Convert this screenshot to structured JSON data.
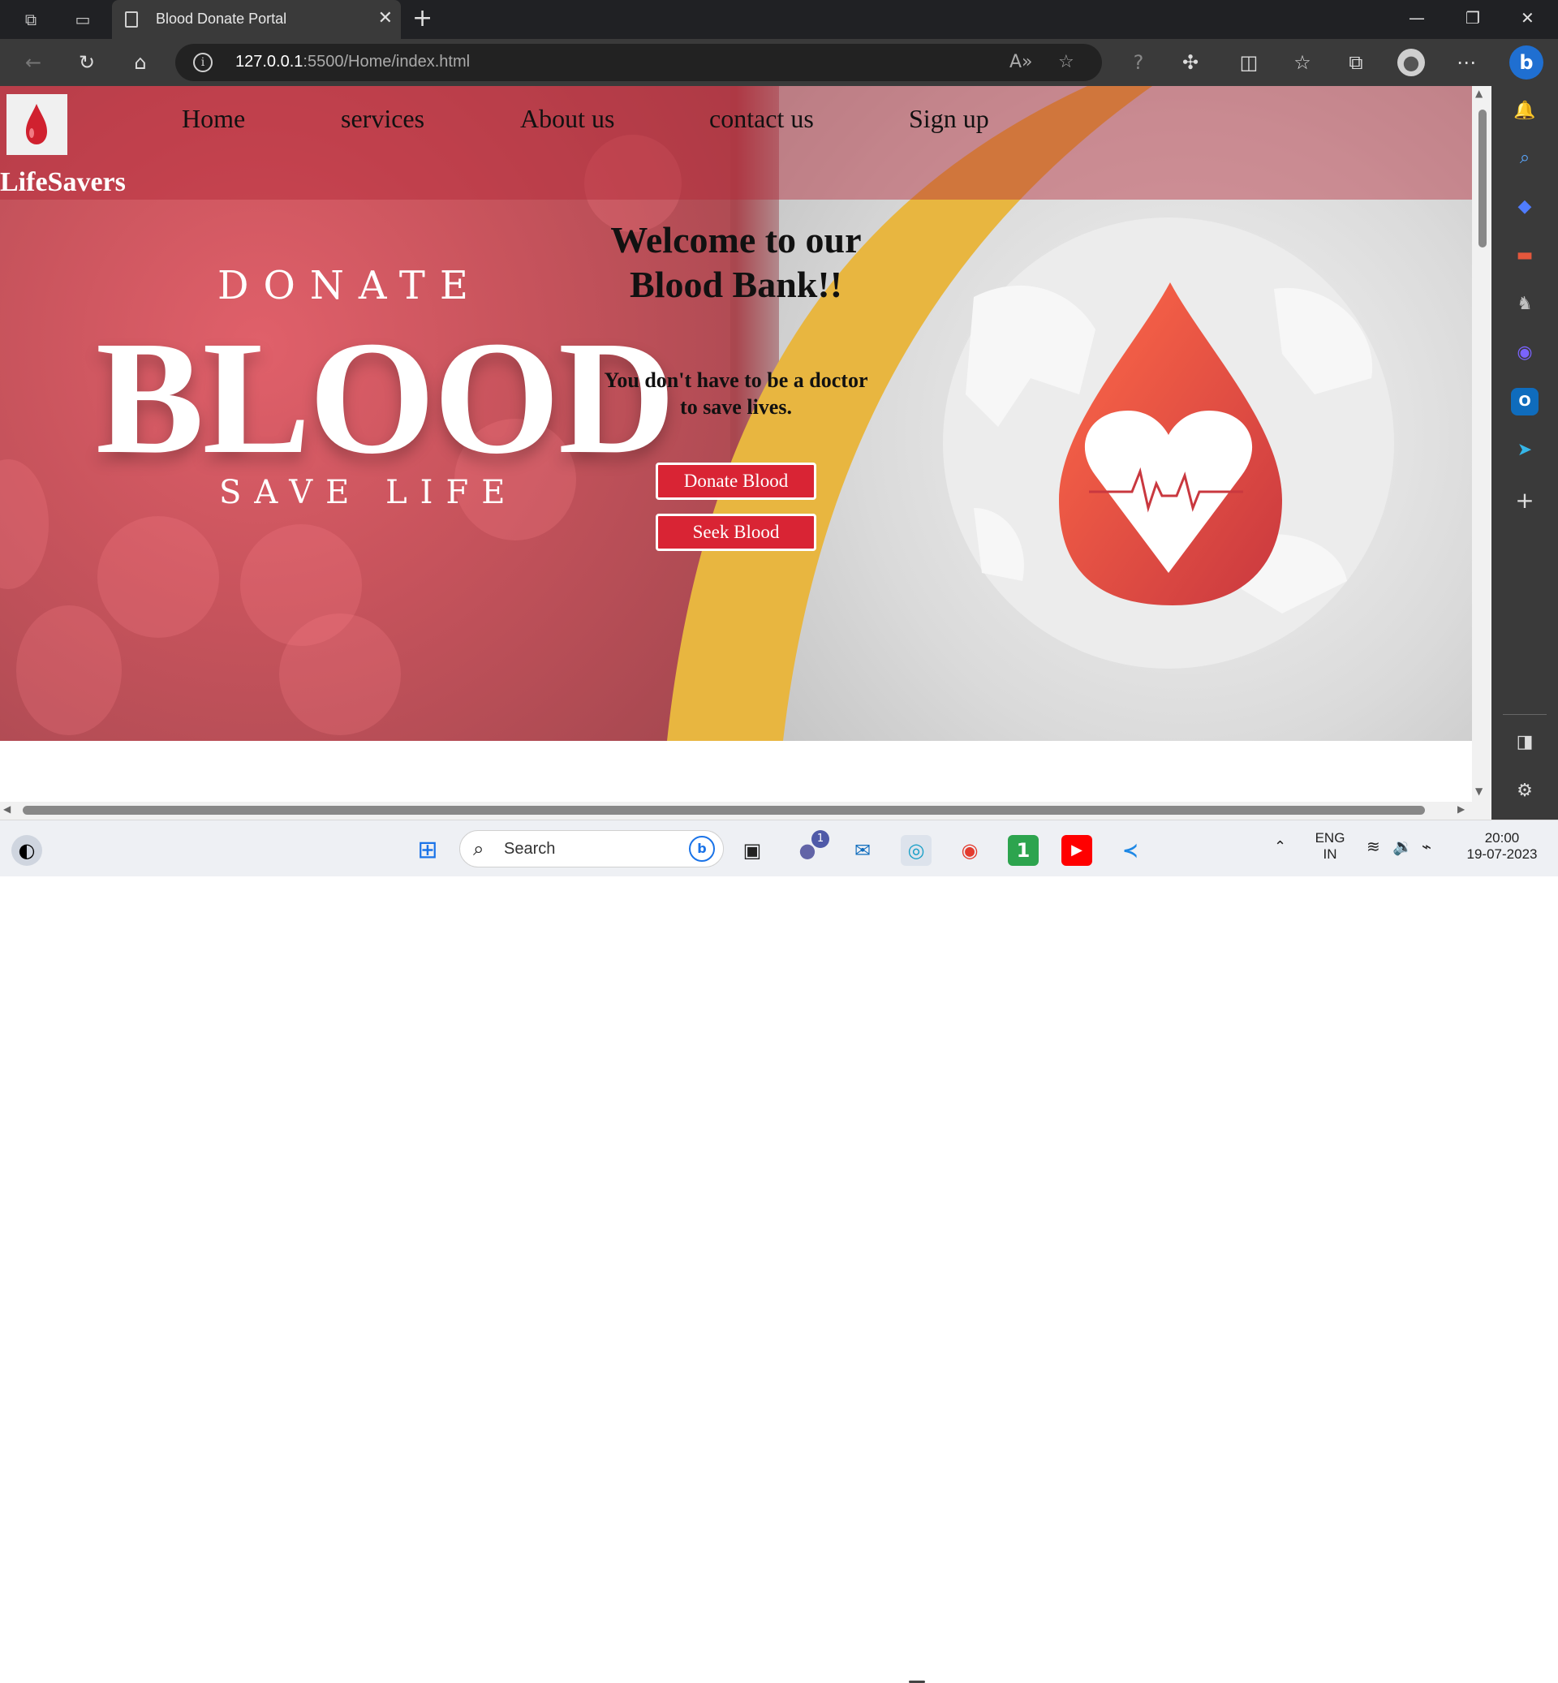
{
  "browser": {
    "tab_title": "Blood Donate Portal",
    "url_host": "127.0.0.1",
    "url_rest": ":5500/Home/index.html"
  },
  "site": {
    "brand": "LifeSavers",
    "nav": [
      "Home",
      "services",
      "About us",
      "contact us",
      "Sign up"
    ],
    "hero": {
      "donate": "DONATE",
      "blood": "BLOOD",
      "save_life": "SAVE LIFE"
    },
    "welcome": "Welcome to our Blood Bank!!",
    "tagline": "You don't have to be a doctor to save lives.",
    "buttons": {
      "donate": "Donate Blood",
      "seek": "Seek Blood"
    }
  },
  "taskbar": {
    "search_placeholder": "Search",
    "teams_badge": "1",
    "lang_top": "ENG",
    "lang_bottom": "IN",
    "time": "20:00",
    "date": "19-07-2023"
  },
  "colors": {
    "accent_red": "#d92434",
    "chrome_dark": "#202124",
    "swoosh_yellow": "#e8b640"
  }
}
